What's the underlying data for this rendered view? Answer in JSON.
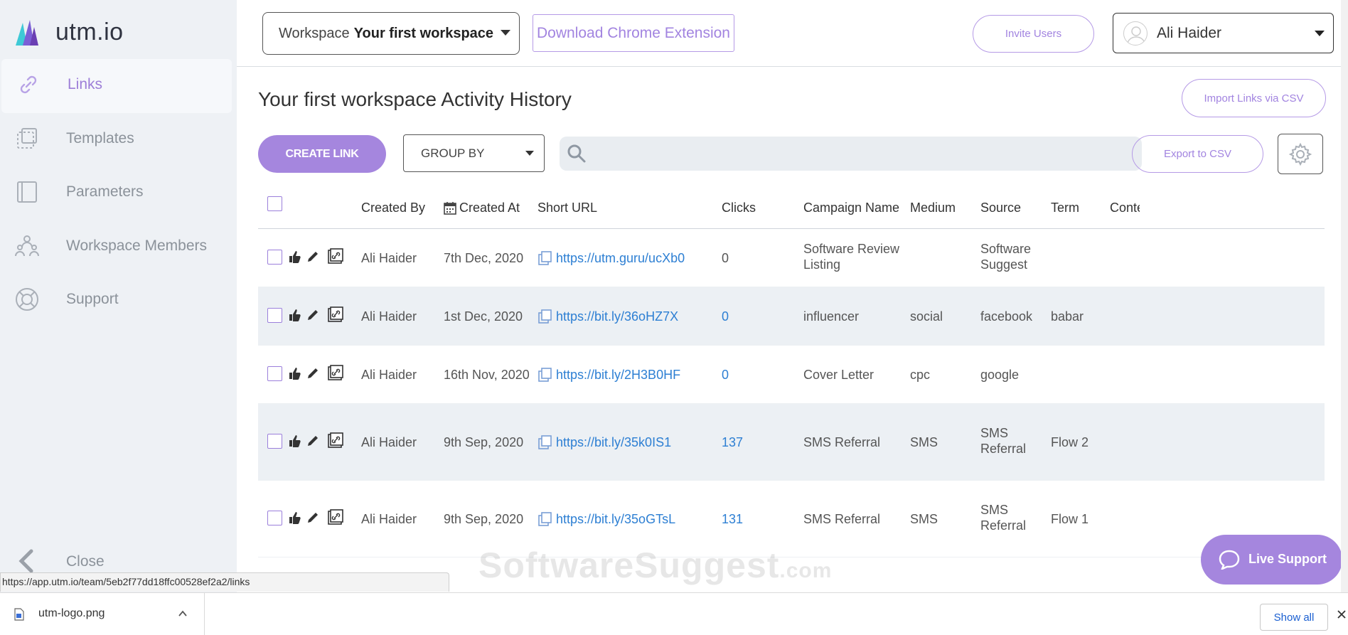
{
  "brand": {
    "name": "utm.io"
  },
  "sidebar": {
    "items": [
      {
        "label": "Links",
        "icon": "link-icon",
        "active": true
      },
      {
        "label": "Templates",
        "icon": "templates-icon",
        "active": false
      },
      {
        "label": "Parameters",
        "icon": "parameters-icon",
        "active": false
      },
      {
        "label": "Workspace Members",
        "icon": "members-icon",
        "active": false
      },
      {
        "label": "Support",
        "icon": "support-icon",
        "active": false
      }
    ],
    "close_label": "Close"
  },
  "header": {
    "workspace_prefix": "Workspace",
    "workspace_name": "Your first workspace",
    "chrome_extension_label": "Download Chrome Extension",
    "invite_label": "Invite Users",
    "user_name": "Ali Haider"
  },
  "main": {
    "title": "Your first workspace Activity History",
    "import_label": "Import Links via CSV",
    "create_label": "CREATE LINK",
    "group_by_label": "GROUP BY",
    "search_placeholder": "",
    "export_label": "Export to CSV"
  },
  "table": {
    "headers": {
      "created_by": "Created By",
      "created_at": "Created At",
      "short_url": "Short URL",
      "clicks": "Clicks",
      "campaign": "Campaign Name",
      "medium": "Medium",
      "source": "Source",
      "term": "Term",
      "content": "Conter"
    },
    "rows": [
      {
        "created_by": "Ali Haider",
        "created_at": "7th Dec, 2020",
        "short_url": "https://utm.guru/ucXb0",
        "clicks": "0",
        "clicks_link": false,
        "campaign": [
          "Software Review",
          "Listing"
        ],
        "medium": "",
        "source": [
          "Software",
          "Suggest"
        ],
        "term": ""
      },
      {
        "created_by": "Ali Haider",
        "created_at": "1st Dec, 2020",
        "short_url": "https://bit.ly/36oHZ7X",
        "clicks": "0",
        "clicks_link": true,
        "campaign": [
          "influencer"
        ],
        "medium": "social",
        "source": [
          "facebook"
        ],
        "term": "babar"
      },
      {
        "created_by": "Ali Haider",
        "created_at": "16th Nov, 2020",
        "short_url": "https://bit.ly/2H3B0HF",
        "clicks": "0",
        "clicks_link": true,
        "campaign": [
          "Cover Letter"
        ],
        "medium": "cpc",
        "source": [
          "google"
        ],
        "term": ""
      },
      {
        "created_by": "Ali Haider",
        "created_at": "9th Sep, 2020",
        "short_url": "https://bit.ly/35k0IS1",
        "clicks": "137",
        "clicks_link": true,
        "campaign": [
          "SMS Referral"
        ],
        "medium": "SMS",
        "source": [
          "SMS",
          "Referral"
        ],
        "term": "Flow 2"
      },
      {
        "created_by": "Ali Haider",
        "created_at": "9th Sep, 2020",
        "short_url": "https://bit.ly/35oGTsL",
        "clicks": "131",
        "clicks_link": true,
        "campaign": [
          "SMS Referral"
        ],
        "medium": "SMS",
        "source": [
          "SMS",
          "Referral"
        ],
        "term": "Flow 1"
      }
    ]
  },
  "status_bar": {
    "url": "https://app.utm.io/team/5eb2f77dd18ffc00528ef2a2/links"
  },
  "download_bar": {
    "file_name": "utm-logo.png",
    "show_all_label": "Show all"
  },
  "watermark": {
    "text": "SoftwareSuggest",
    "suffix": ".com"
  },
  "live_support": {
    "label": "Live Support"
  },
  "colors": {
    "accent": "#a586de",
    "link": "#2d7fd3",
    "sidebar_bg": "#eef1f5",
    "row_alt": "#ecf0f4"
  }
}
